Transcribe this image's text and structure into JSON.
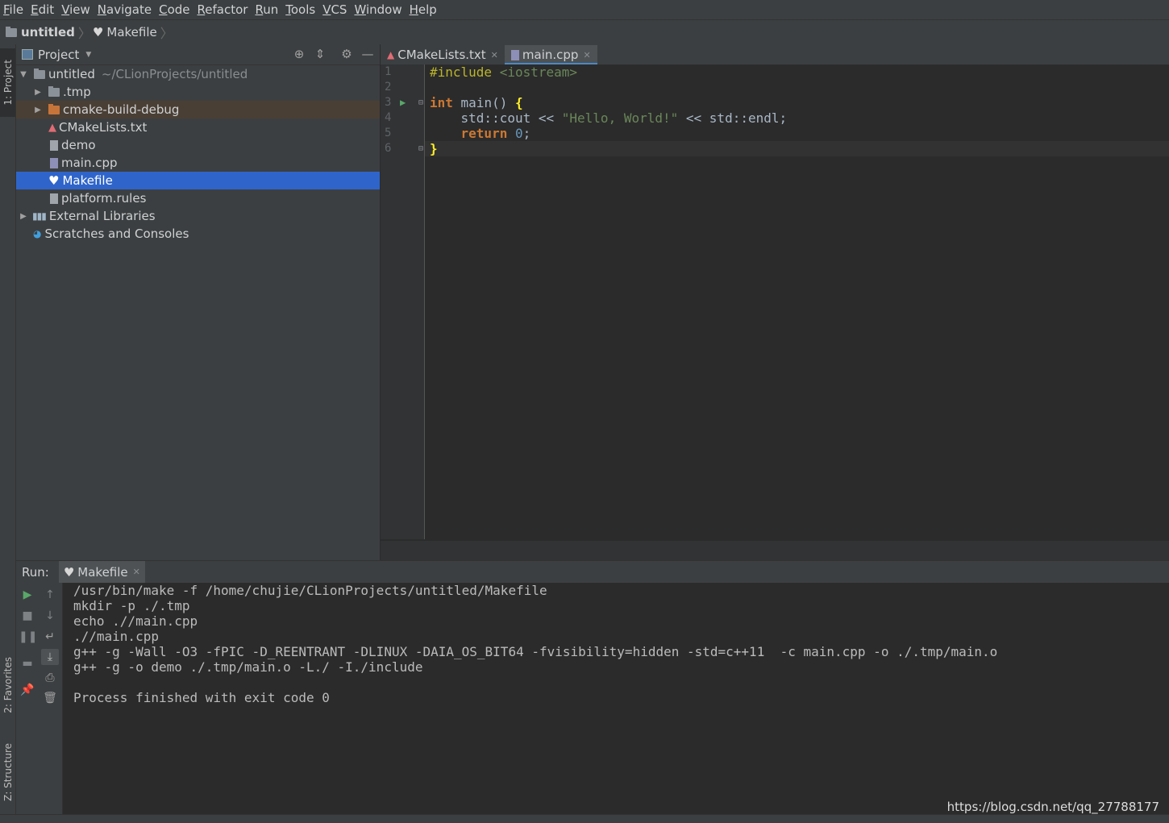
{
  "menu": [
    "File",
    "Edit",
    "View",
    "Navigate",
    "Code",
    "Refactor",
    "Run",
    "Tools",
    "VCS",
    "Window",
    "Help"
  ],
  "breadcrumb": {
    "project": "untitled",
    "file": "Makefile"
  },
  "left_tool_tabs": {
    "project": "1: Project",
    "favorites": "2: Favorites",
    "structure": "Z: Structure"
  },
  "project_panel": {
    "title": "Project",
    "tree": [
      {
        "label": "untitled",
        "sub": "~/CLionProjects/untitled",
        "expanded": true
      },
      {
        "label": ".tmp"
      },
      {
        "label": "cmake-build-debug"
      },
      {
        "label": "CMakeLists.txt"
      },
      {
        "label": "demo"
      },
      {
        "label": "main.cpp"
      },
      {
        "label": "Makefile",
        "selected": true
      },
      {
        "label": "platform.rules"
      },
      {
        "label": "External Libraries"
      },
      {
        "label": "Scratches and Consoles"
      }
    ]
  },
  "editor": {
    "tabs": [
      {
        "label": "CMakeLists.txt",
        "active": false
      },
      {
        "label": "main.cpp",
        "active": true
      }
    ],
    "line_numbers": [
      "1",
      "2",
      "3",
      "4",
      "5",
      "6"
    ],
    "code": {
      "l1_pre": "#include",
      "l1_inc": "<iostream>",
      "l3_kw": "int",
      "l3_rest": " main() ",
      "l3_brace": "{",
      "l4_a": "    std::cout << ",
      "l4_str": "\"Hello, World!\"",
      "l4_b": " << std::endl;",
      "l5_kw": "    return",
      "l5_num": "0",
      "l5_end": ";",
      "l6_brace": "}"
    }
  },
  "run_panel": {
    "label": "Run:",
    "tab": "Makefile",
    "console": [
      "/usr/bin/make -f /home/chujie/CLionProjects/untitled/Makefile",
      "mkdir -p ./.tmp",
      "echo .//main.cpp",
      ".//main.cpp",
      "g++ -g -Wall -O3 -fPIC -D_REENTRANT -DLINUX -DAIA_OS_BIT64 -fvisibility=hidden -std=c++11  -c main.cpp -o ./.tmp/main.o",
      "g++ -g -o demo ./.tmp/main.o -L./ -I./include",
      "",
      "Process finished with exit code 0"
    ]
  },
  "watermark": "https://blog.csdn.net/qq_27788177",
  "colors": {
    "selection": "#2f65ca",
    "keyword": "#cc7832",
    "string": "#6a8759",
    "number": "#6897bb",
    "preproc": "#bbb529",
    "run_icon": "#59a869"
  }
}
